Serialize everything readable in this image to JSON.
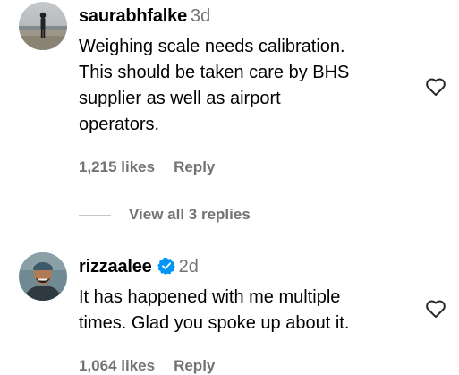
{
  "comments": [
    {
      "username": "saurabhfalke",
      "time": "3d",
      "text_lines": [
        "Weighing scale needs calibration.",
        "This should be taken care by BHS",
        "supplier as well as airport",
        "operators."
      ],
      "likes": "1,215 likes",
      "reply_label": "Reply",
      "verified": false,
      "like_icon": "heart-outline-icon"
    },
    {
      "username": "rizzaalee",
      "time": "2d",
      "text_lines": [
        "It has happened with me multiple",
        "times. Glad you spoke up about it."
      ],
      "likes": "1,064 likes",
      "reply_label": "Reply",
      "verified": true,
      "like_icon": "heart-outline-icon"
    }
  ],
  "view_replies_label": "View all 3 replies",
  "colors": {
    "text": "#000000",
    "muted": "#737373",
    "verified": "#0095f6",
    "divider": "#c7c7c7"
  }
}
